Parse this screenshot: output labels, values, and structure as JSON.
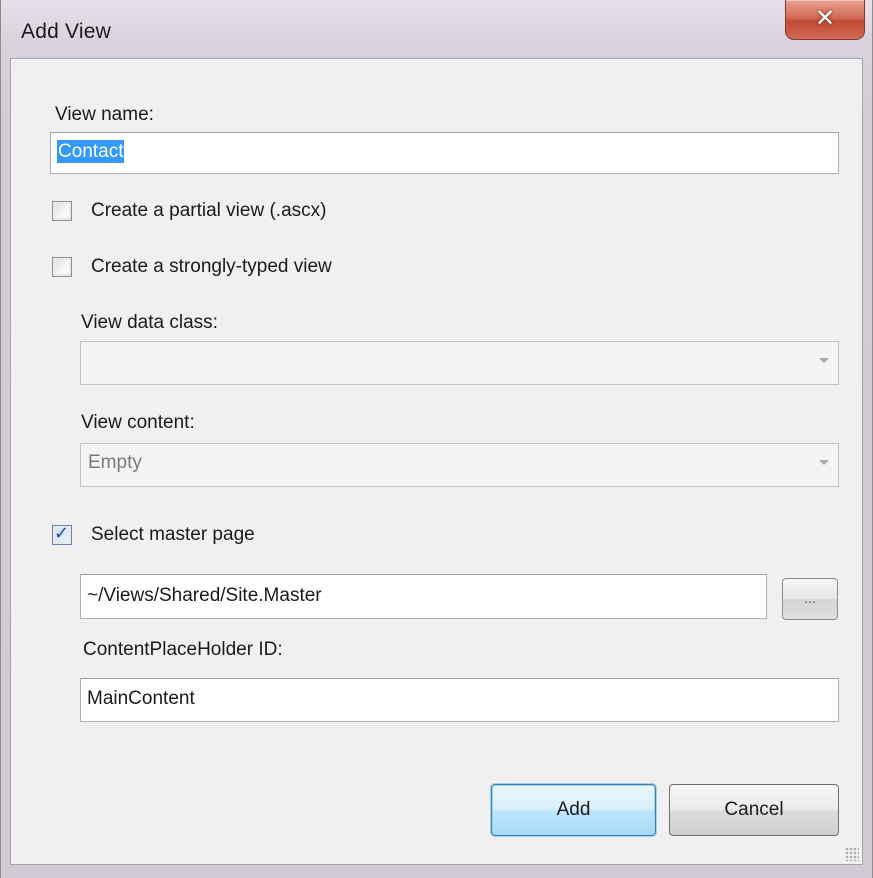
{
  "window": {
    "title": "Add View",
    "close_glyph": "✕"
  },
  "form": {
    "view_name_label": "View name:",
    "view_name_value": "Contact",
    "partial_view": {
      "label": "Create a partial view (.ascx)",
      "checked": false
    },
    "strongly_typed": {
      "label": "Create a strongly-typed view",
      "checked": false
    },
    "view_data_class_label": "View data class:",
    "view_data_class_value": "",
    "view_content_label": "View content:",
    "view_content_value": "Empty",
    "master_page": {
      "label": "Select master page",
      "checked": true,
      "check_glyph": "✓"
    },
    "master_page_path": "~/Views/Shared/Site.Master",
    "browse_label": "...",
    "placeholder_id_label": "ContentPlaceHolder ID:",
    "placeholder_id_value": "MainContent"
  },
  "buttons": {
    "add": "Add",
    "cancel": "Cancel"
  },
  "icons": {
    "close": "close-icon",
    "checkbox_checked": "checkmark-icon",
    "dropdown": "chevron-down-icon",
    "grip": "resize-grip-icon"
  },
  "colors": {
    "selection": "#3399ff",
    "close_button": "#c24a33",
    "default_button": "#bee6fd"
  }
}
